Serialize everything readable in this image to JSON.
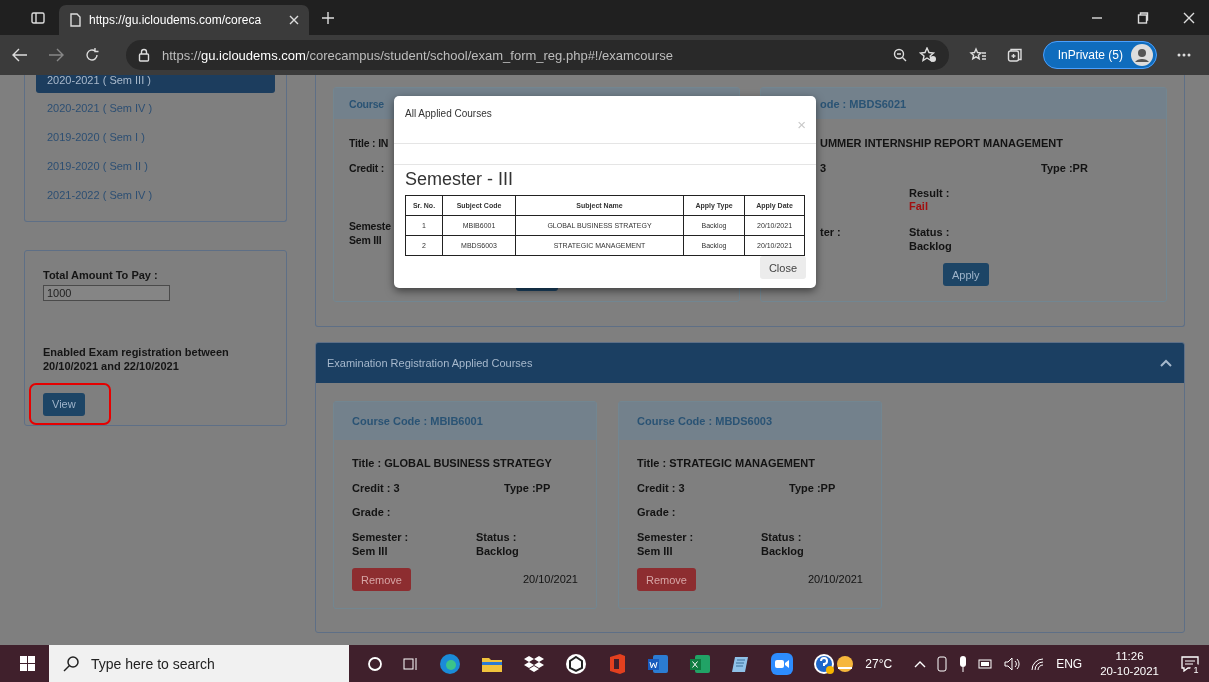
{
  "browser": {
    "tab": {
      "title": "https://gu.icloudems.com/coreca"
    },
    "url": "https://**gu.icloudems.com**/corecampus/student/school/exam_form_reg.php#!/examcourse",
    "profile": "InPrivate (5)"
  },
  "sidebar": {
    "sessions": [
      {
        "label": "2020-2021 ( Sem III )",
        "selected": true
      },
      {
        "label": "2020-2021 ( Sem IV )",
        "selected": false
      },
      {
        "label": "2019-2020 ( Sem I )",
        "selected": false
      },
      {
        "label": "2019-2020 ( Sem II )",
        "selected": false
      },
      {
        "label": "2021-2022 ( Sem IV )",
        "selected": false
      }
    ],
    "payment": {
      "label": "Total Amount To Pay :",
      "value": "1000"
    },
    "notice": "Enabled Exam registration between 20/10/2021 and 22/10/2021",
    "view_button": {
      "label": "View",
      "highlighted": true
    }
  },
  "available_courses": {
    "left_card": {
      "header": "Course",
      "title": "Title : IN",
      "credit": "Credit :",
      "semester_label": "Semeste",
      "semester": "Sem III"
    },
    "right_card": {
      "header": "ode : MBDS6021",
      "title": "UMMER INTERNSHIP REPORT MANAGEMENT",
      "credit": "3",
      "type": "Type :PR",
      "result_label": "Result :",
      "result": "Fail",
      "semester_label": "ter :",
      "status_label": "Status :",
      "status": "Backlog",
      "button": "Apply"
    }
  },
  "modal": {
    "title": "All Applied Courses",
    "close_icon": "×",
    "heading": "Semester - III",
    "table": {
      "columns": [
        "Sr. No.",
        "Subject Code",
        "Subject Name",
        "Apply Type",
        "Apply Date"
      ],
      "rows": [
        [
          "1",
          "MBIB6001",
          "GLOBAL BUSINESS STRATEGY",
          "Backlog",
          "20/10/2021"
        ],
        [
          "2",
          "MBDS6003",
          "STRATEGIC MANAGEMENT",
          "Backlog",
          "20/10/2021"
        ]
      ]
    },
    "close_button": "Close"
  },
  "applied_courses": {
    "header": "Examination Registration Applied Courses",
    "expanded": true,
    "cards": [
      {
        "code": "Course Code : MBIB6001",
        "title": "Title : GLOBAL BUSINESS STRATEGY",
        "credit": "Credit : 3",
        "type": "Type :PP",
        "grade": "Grade :",
        "semester_label": "Semester :",
        "semester": "Sem III",
        "status_label": "Status :",
        "status": "Backlog",
        "button": "Remove",
        "date": "20/10/2021"
      },
      {
        "code": "Course Code : MBDS6003",
        "title": "Title : STRATEGIC MANAGEMENT",
        "credit": "Credit : 3",
        "type": "Type :PP",
        "grade": "Grade :",
        "semester_label": "Semester :",
        "semester": "Sem III",
        "status_label": "Status :",
        "status": "Backlog",
        "button": "Remove",
        "date": "20/10/2021"
      }
    ]
  },
  "taskbar": {
    "search_placeholder": "Type here to search",
    "temperature": "27°C",
    "language": "ENG",
    "time": "11:26",
    "date": "20-10-2021",
    "notifications": "1"
  }
}
